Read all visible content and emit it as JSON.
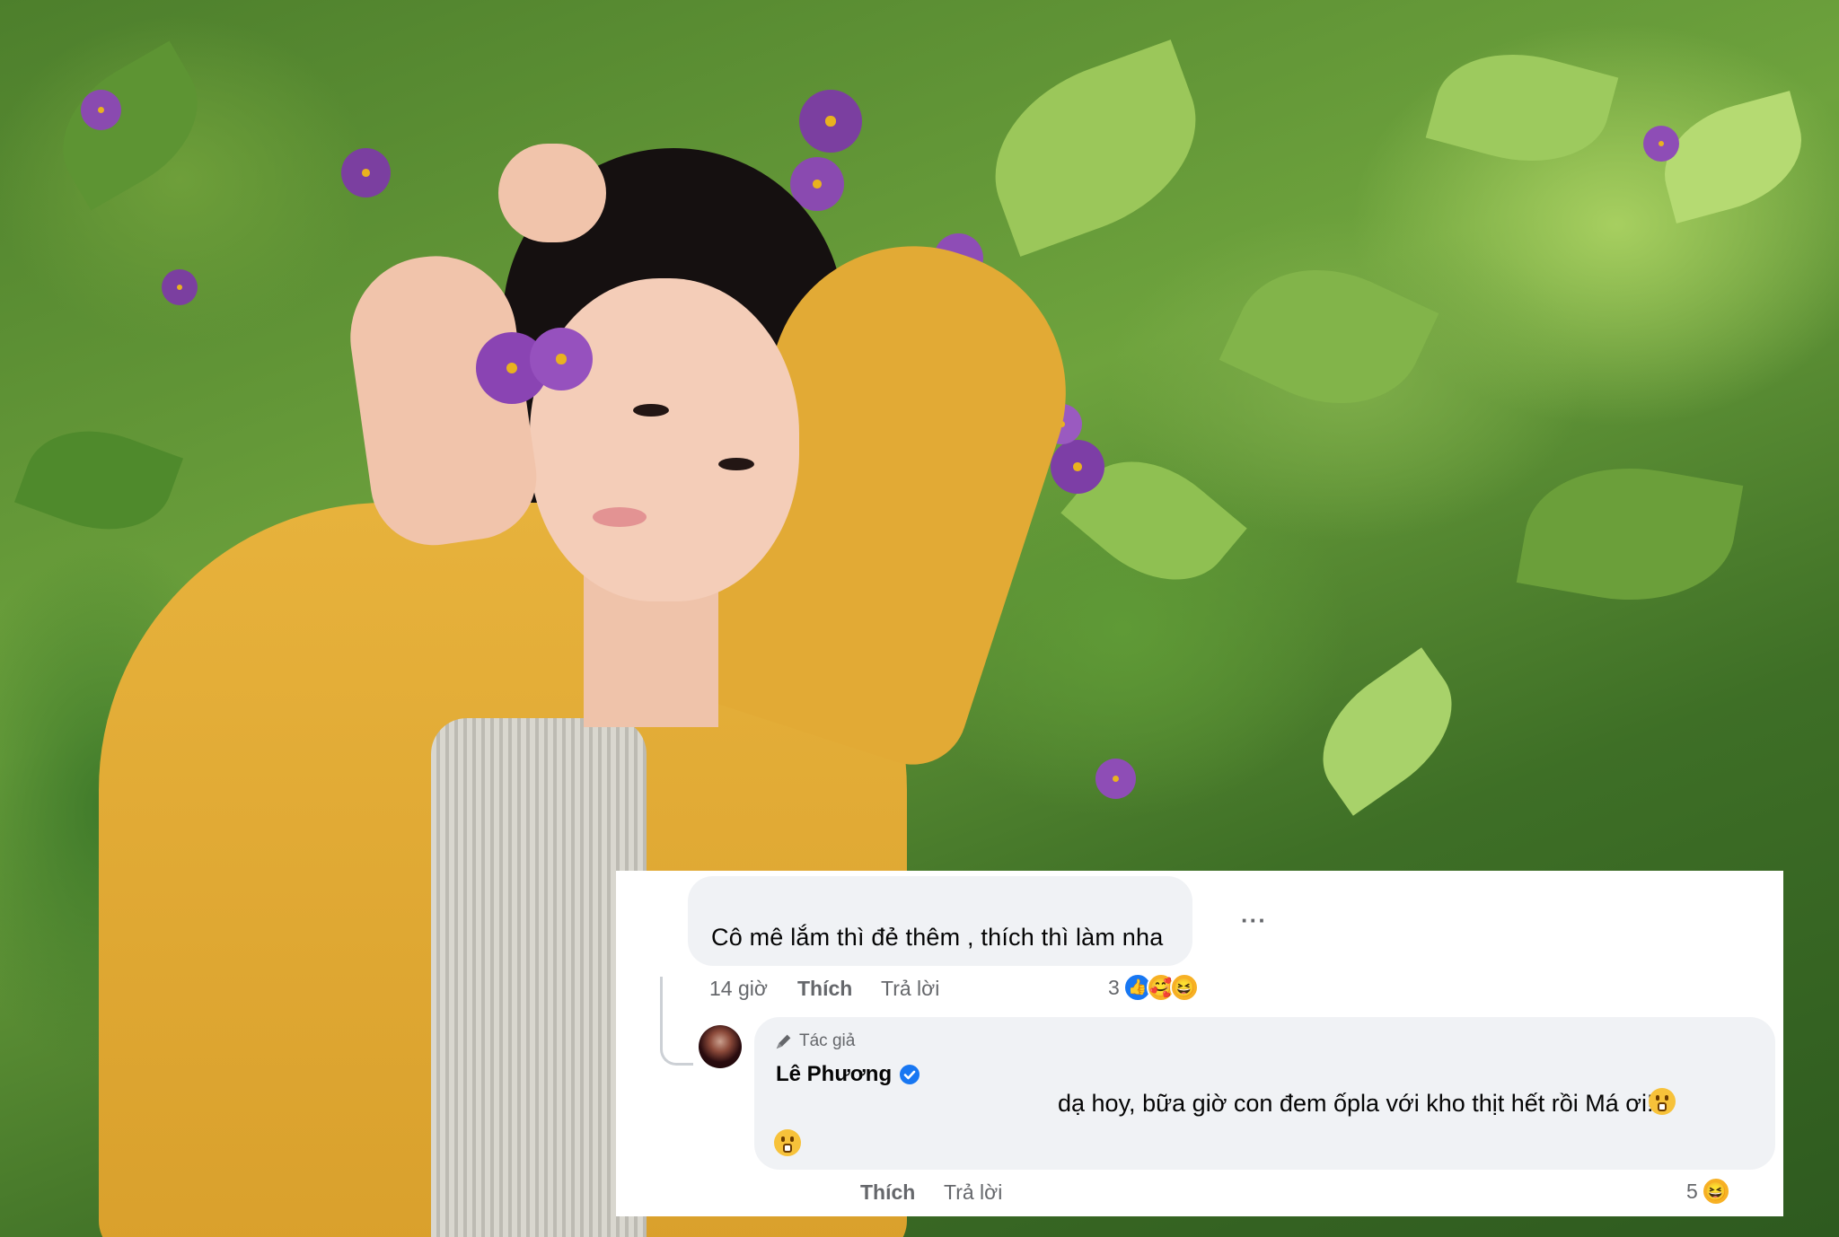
{
  "comment_1": {
    "text": "Cô mê lắm thì đẻ thêm , thích thì làm nha",
    "time": "14 giờ",
    "like_action": "Thích",
    "reply_action": "Trả lời",
    "reaction_count": "3",
    "reactions": [
      "like-icon",
      "care-icon",
      "haha-icon"
    ],
    "more_icon": "more-dots-icon"
  },
  "comment_2": {
    "author_label": "Tác giả",
    "author_name": "Lê Phương",
    "verified_icon": "verified-badge-icon",
    "text": "dạ hoy, bữa giờ con đem ốpla với kho thịt hết rồi Má ơi!",
    "emojis": [
      "grimace-emoji",
      "grimace-emoji"
    ],
    "like_action": "Thích",
    "reply_action": "Trả lời",
    "reaction_count": "5",
    "reactions": [
      "haha-icon"
    ]
  },
  "colors": {
    "bubble": "#f0f2f5",
    "text": "#050505",
    "meta": "#65676b",
    "like_blue": "#1877f2",
    "reaction_yellow": "#f7b125"
  }
}
